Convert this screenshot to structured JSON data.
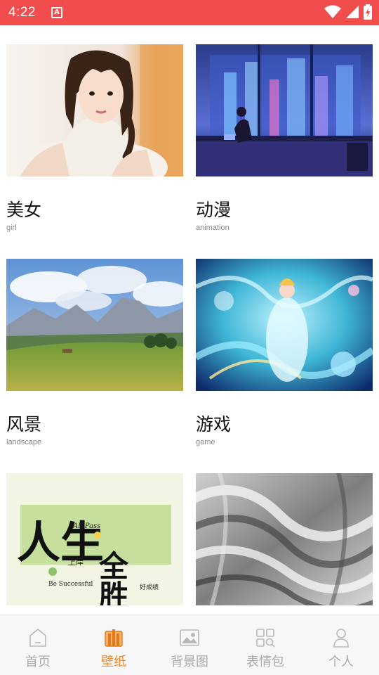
{
  "status": {
    "time": "4:22",
    "notif_icon": "A"
  },
  "cards": [
    {
      "title": "美女",
      "subtitle": "girl"
    },
    {
      "title": "动漫",
      "subtitle": "animation"
    },
    {
      "title": "风景",
      "subtitle": "landscape"
    },
    {
      "title": "游戏",
      "subtitle": "game"
    },
    {
      "title": "",
      "subtitle": ""
    },
    {
      "title": "",
      "subtitle": ""
    }
  ],
  "calligraphy": {
    "main1": "人生",
    "main2": "全胜",
    "line1": "All Pass",
    "line2": "上岸",
    "line3": "Be Successful",
    "line4": "好成绩"
  },
  "tabs": [
    {
      "label": "首页",
      "icon": "home-icon"
    },
    {
      "label": "壁纸",
      "icon": "wallpaper-icon",
      "active": true
    },
    {
      "label": "背景图",
      "icon": "image-icon"
    },
    {
      "label": "表情包",
      "icon": "sticker-grid-icon"
    },
    {
      "label": "个人",
      "icon": "person-icon"
    }
  ],
  "colors": {
    "status_bar": "#f24d4d",
    "accent": "#f28a2e",
    "tab_inactive": "#aaaaaa"
  }
}
